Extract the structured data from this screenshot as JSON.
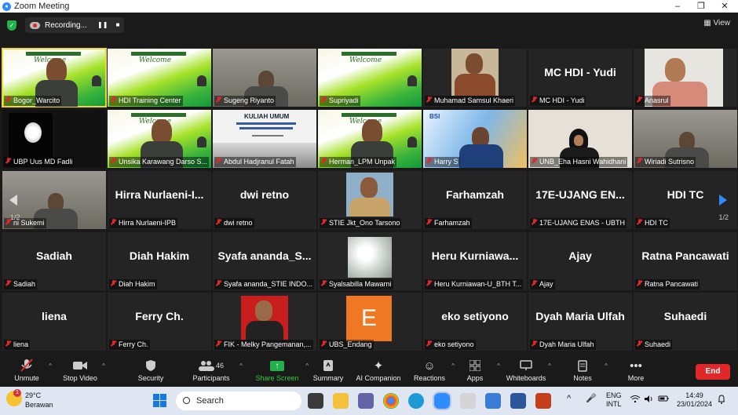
{
  "window": {
    "title": "Zoom Meeting",
    "controls": [
      "–",
      "❐",
      "✕"
    ]
  },
  "recording": {
    "label": "Recording...",
    "pause_icon": "pause-icon",
    "stop_icon": "stop-icon"
  },
  "view_button": "View",
  "pager": {
    "left": "1/2",
    "right": "1/2"
  },
  "participants_grid": [
    {
      "name": "Bogor_Warcito",
      "kind": "slide-person",
      "active": true
    },
    {
      "name": "HDI Training Center",
      "kind": "slide"
    },
    {
      "name": "Sugeng Riyanto",
      "kind": "video-room"
    },
    {
      "name": "Supriyadi",
      "kind": "slide"
    },
    {
      "name": "Muhamad Samsul Khaeri",
      "kind": "photo-batik"
    },
    {
      "name": "MC HDI - Yudi",
      "big": "MC HDI - Yudi",
      "kind": "name"
    },
    {
      "name": "Anasrul",
      "kind": "photo-light"
    },
    {
      "name": "UBP Uus MD Fadli",
      "kind": "dark-light"
    },
    {
      "name": "Unsika Karawang Darso S...",
      "kind": "slide-person"
    },
    {
      "name": "Abdul Hadjranul Fatah",
      "kind": "doc",
      "doc_title": "KULIAH UMUM"
    },
    {
      "name": "Herman_LPM Unpak",
      "kind": "slide-person"
    },
    {
      "name": "Harry S",
      "kind": "bsi"
    },
    {
      "name": "UNB_Eha Hasni Wahidhani",
      "kind": "video-hijab"
    },
    {
      "name": "Wiriadi Sutrisno",
      "kind": "video-room"
    },
    {
      "name": "ni Sukemi",
      "kind": "video-room"
    },
    {
      "name": "Hirra Nurlaeni-IPB",
      "big": "Hirra Nurlaeni-I...",
      "kind": "name"
    },
    {
      "name": "dwi retno",
      "big": "dwi retno",
      "kind": "name"
    },
    {
      "name": "STIE Jkt_Ono Tarsono",
      "kind": "photo-portrait"
    },
    {
      "name": "Farhamzah",
      "big": "Farhamzah",
      "kind": "name"
    },
    {
      "name": "17E-UJANG ENAS - UBTH",
      "big": "17E-UJANG  EN...",
      "kind": "name"
    },
    {
      "name": "HDI TC",
      "big": "HDI TC",
      "kind": "name"
    },
    {
      "name": "Sadiah",
      "big": "Sadiah",
      "kind": "name"
    },
    {
      "name": "Diah Hakim",
      "big": "Diah Hakim",
      "kind": "name"
    },
    {
      "name": "Syafa ananda_STIE INDO...",
      "big": "Syafa ananda_S...",
      "kind": "name"
    },
    {
      "name": "Syalsabilla Mawarni",
      "kind": "photo-flower"
    },
    {
      "name": "Heru Kurniawan-U_BTH T...",
      "big": "Heru  Kurniawa...",
      "kind": "name"
    },
    {
      "name": "Ajay",
      "big": "Ajay",
      "kind": "name"
    },
    {
      "name": "Ratna Pancawati",
      "big": "Ratna Pancawati",
      "kind": "name"
    },
    {
      "name": "liena",
      "big": "liena",
      "kind": "name"
    },
    {
      "name": "Ferry Ch.",
      "big": "Ferry Ch.",
      "kind": "name"
    },
    {
      "name": "FIK - Melky Pangemanan,...",
      "kind": "photo-red"
    },
    {
      "name": "UBS_Endang",
      "kind": "avatar-e",
      "avatar_letter": "E"
    },
    {
      "name": "eko setiyono",
      "big": "eko setiyono",
      "kind": "name"
    },
    {
      "name": "Dyah Maria Ulfah",
      "big": "Dyah Maria Ulfah",
      "kind": "name"
    },
    {
      "name": "Suhaedi",
      "big": "Suhaedi",
      "kind": "name"
    }
  ],
  "toolbar": {
    "unmute": "Unmute",
    "stop_video": "Stop Video",
    "security": "Security",
    "participants": "Participants",
    "participants_count": "46",
    "share_screen": "Share Screen",
    "summary": "Summary",
    "ai_companion": "AI Companion",
    "reactions": "Reactions",
    "apps": "Apps",
    "whiteboards": "Whiteboards",
    "notes": "Notes",
    "more": "More",
    "end": "End"
  },
  "taskbar": {
    "weather_temp": "29°C",
    "weather_desc": "Berawan",
    "weather_badge": "1",
    "search_placeholder": "Search",
    "lang1": "ENG",
    "lang2": "INTL",
    "time": "14:49",
    "date": "23/01/2024"
  },
  "colors": {
    "end": "#e02828",
    "share": "#22b14c",
    "active_border": "#f2d538",
    "muted_mic": "#e02828"
  }
}
